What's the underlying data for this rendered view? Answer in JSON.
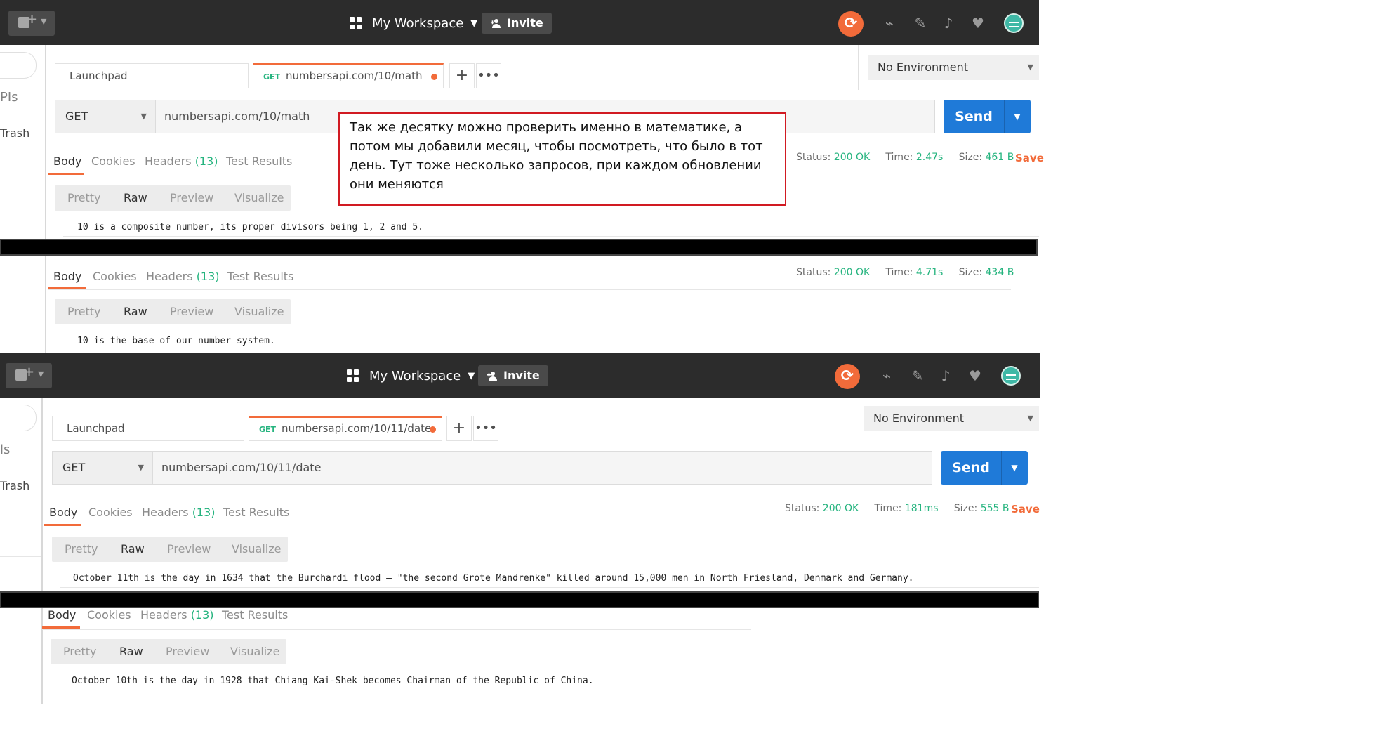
{
  "workspace": {
    "name": "My Workspace",
    "invite_label": "Invite"
  },
  "sidebar": {
    "item_apis": "PIs",
    "item_apis_2": "ls",
    "item_trash": "Trash"
  },
  "environment": "No Environment",
  "colors": {
    "accent": "#f26b3a",
    "send": "#1f7ad8",
    "success": "#26b47f",
    "callout_border": "#d11a22"
  },
  "panel1": {
    "tabs": {
      "launchpad": "Launchpad",
      "request_method": "GET",
      "request_title": "numbersapi.com/10/math"
    },
    "method": "GET",
    "url": "numbersapi.com/10/math",
    "send_label": "Send",
    "response_tabs": {
      "body": "Body",
      "cookies": "Cookies",
      "headers": "Headers",
      "headers_count": "(13)",
      "tests": "Test Results"
    },
    "status": {
      "status_label": "Status:",
      "status": "200 OK",
      "time_label": "Time:",
      "time": "2.47s",
      "size_label": "Size:",
      "size": "461 B"
    },
    "save_label": "Save",
    "formats": [
      "Pretty",
      "Raw",
      "Preview",
      "Visualize"
    ],
    "response": "10 is a composite number, its proper divisors being 1, 2 and 5."
  },
  "panel1b": {
    "response_tabs": {
      "body": "Body",
      "cookies": "Cookies",
      "headers": "Headers",
      "headers_count": "(13)",
      "tests": "Test Results"
    },
    "status": {
      "status_label": "Status:",
      "status": "200 OK",
      "time_label": "Time:",
      "time": "4.71s",
      "size_label": "Size:",
      "size": "434 B"
    },
    "formats": [
      "Pretty",
      "Raw",
      "Preview",
      "Visualize"
    ],
    "response": "10 is the base of our number system."
  },
  "panel2": {
    "tabs": {
      "launchpad": "Launchpad",
      "request_method": "GET",
      "request_title": "numbersapi.com/10/11/date"
    },
    "method": "GET",
    "url": "numbersapi.com/10/11/date",
    "send_label": "Send",
    "response_tabs": {
      "body": "Body",
      "cookies": "Cookies",
      "headers": "Headers",
      "headers_count": "(13)",
      "tests": "Test Results"
    },
    "status": {
      "status_label": "Status:",
      "status": "200 OK",
      "time_label": "Time:",
      "time": "181ms",
      "size_label": "Size:",
      "size": "555 B"
    },
    "save_label": "Save",
    "formats": [
      "Pretty",
      "Raw",
      "Preview",
      "Visualize"
    ],
    "response": "October 11th is the day in 1634 that the Burchardi flood – \"the second Grote Mandrenke\" killed around 15,000 men in North Friesland, Denmark and Germany."
  },
  "panel2b": {
    "response_tabs": {
      "body": "Body",
      "cookies": "Cookies",
      "headers": "Headers",
      "headers_count": "(13)",
      "tests": "Test Results"
    },
    "formats": [
      "Pretty",
      "Raw",
      "Preview",
      "Visualize"
    ],
    "response": "October 10th is the day in 1928 that Chiang Kai-Shek becomes Chairman of the Republic of China."
  },
  "callout_text": "Так же десятку можно проверить именно в математике, а потом мы добавили месяц, чтобы посмотреть, что было в тот день. Тут тоже несколько запросов, при каждом обновлении они меняются"
}
